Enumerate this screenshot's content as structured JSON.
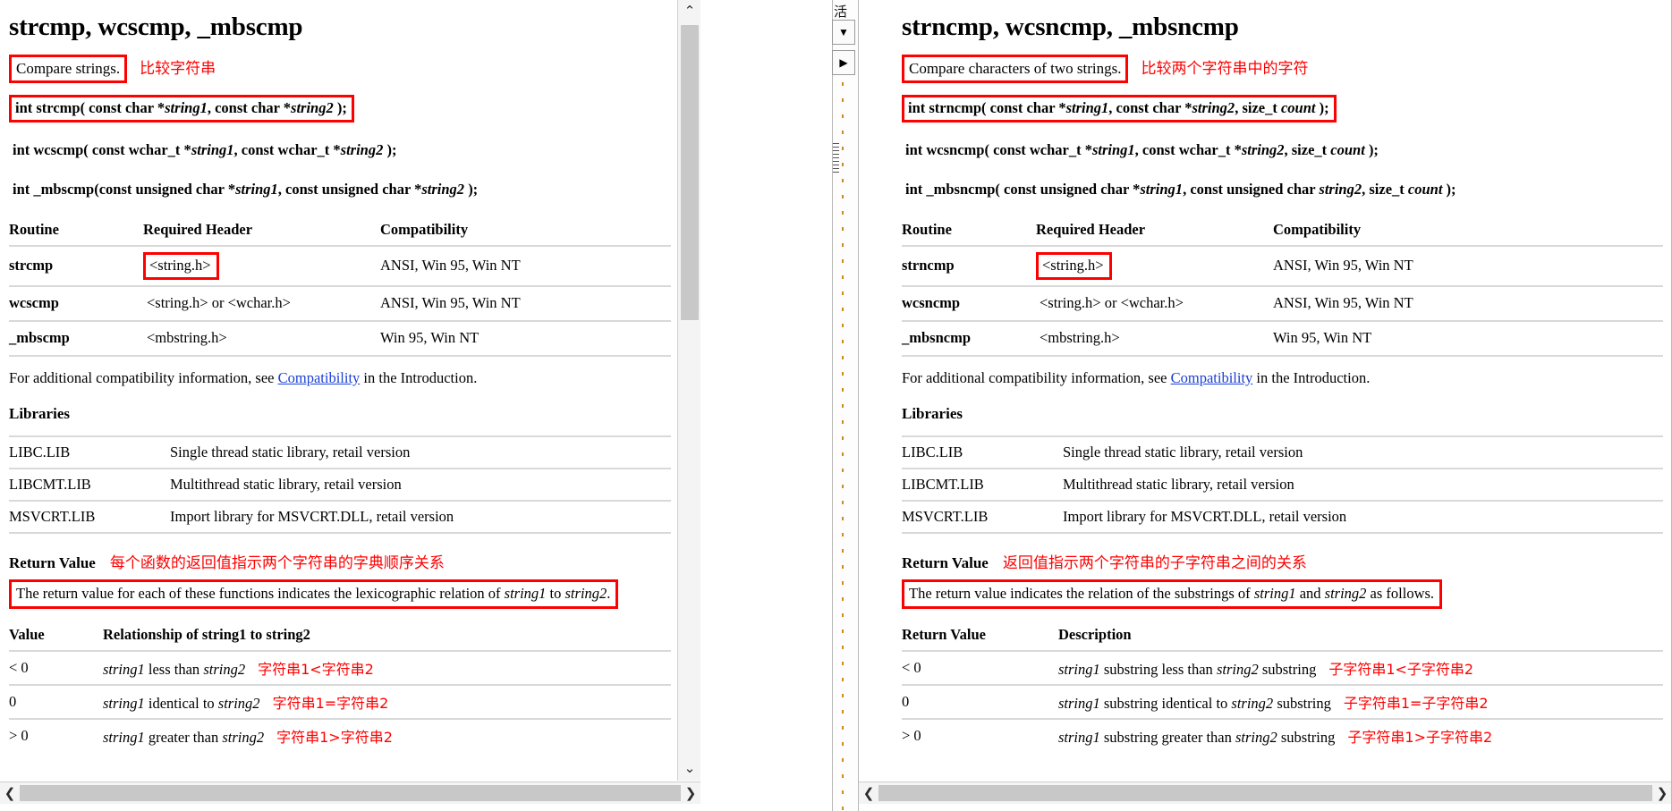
{
  "left": {
    "title": "strcmp, wcscmp, _mbscmp",
    "description": "Compare strings.",
    "description_cn": "比较字符串",
    "prototypes": [
      {
        "boxed": true,
        "parts": [
          {
            "t": "int strcmp( const char *",
            "i": false
          },
          {
            "t": "string1",
            "i": true
          },
          {
            "t": ", const char *",
            "i": false
          },
          {
            "t": "string2",
            "i": true
          },
          {
            "t": " );",
            "i": false
          }
        ]
      },
      {
        "boxed": false,
        "parts": [
          {
            "t": "int wcscmp( const wchar_t *",
            "i": false
          },
          {
            "t": "string1",
            "i": true
          },
          {
            "t": ", const wchar_t *",
            "i": false
          },
          {
            "t": "string2",
            "i": true
          },
          {
            "t": " );",
            "i": false
          }
        ]
      },
      {
        "boxed": false,
        "parts": [
          {
            "t": "int _mbscmp(const unsigned char *",
            "i": false
          },
          {
            "t": "string1",
            "i": true
          },
          {
            "t": ", const unsigned char *",
            "i": false
          },
          {
            "t": "string2",
            "i": true
          },
          {
            "t": " );",
            "i": false
          }
        ]
      }
    ],
    "routine_table": {
      "headers": [
        "Routine",
        "Required Header",
        "Compatibility"
      ],
      "rows": [
        {
          "routine": "strcmp",
          "header": "<string.h>",
          "header_boxed": true,
          "compat": "ANSI, Win 95, Win NT"
        },
        {
          "routine": "wcscmp",
          "header": "<string.h> or <wchar.h>",
          "header_boxed": false,
          "compat": "ANSI, Win 95, Win NT"
        },
        {
          "routine": "_mbscmp",
          "header": "<mbstring.h>",
          "header_boxed": false,
          "compat": "Win 95, Win NT"
        }
      ]
    },
    "note_before": "For additional compatibility information, see ",
    "note_link": "Compatibility",
    "note_after": " in the Introduction.",
    "libraries_heading": "Libraries",
    "libraries": [
      {
        "name": "LIBC.LIB",
        "desc": "Single thread static library, retail version"
      },
      {
        "name": "LIBCMT.LIB",
        "desc": "Multithread static library, retail version"
      },
      {
        "name": "MSVCRT.LIB",
        "desc": "Import library for MSVCRT.DLL, retail version"
      }
    ],
    "return_value_label": "Return Value",
    "return_value_cn": "每个函数的返回值指示两个字符串的字典顺序关系",
    "return_value_text_parts": [
      {
        "t": "The return value for each of these functions indicates the lexicographic relation of ",
        "i": false
      },
      {
        "t": "string1",
        "i": true
      },
      {
        "t": " to ",
        "i": false
      },
      {
        "t": "string2",
        "i": true
      },
      {
        "t": ".",
        "i": false
      }
    ],
    "value_table": {
      "headers": [
        "Value",
        "Relationship of string1 to string2"
      ],
      "rows": [
        {
          "value": "< 0",
          "parts": [
            {
              "t": "string1",
              "i": true
            },
            {
              "t": " less than ",
              "i": false
            },
            {
              "t": "string2",
              "i": true
            }
          ],
          "cn": "字符串1<字符串2"
        },
        {
          "value": "0",
          "parts": [
            {
              "t": "string1",
              "i": true
            },
            {
              "t": " identical to ",
              "i": false
            },
            {
              "t": "string2",
              "i": true
            }
          ],
          "cn": "字符串1=字符串2"
        },
        {
          "value": "> 0",
          "parts": [
            {
              "t": "string1",
              "i": true
            },
            {
              "t": " greater than ",
              "i": false
            },
            {
              "t": "string2",
              "i": true
            }
          ],
          "cn": "字符串1>字符串2"
        }
      ]
    }
  },
  "right": {
    "title": "strncmp, wcsncmp, _mbsncmp",
    "description": "Compare characters of two strings.",
    "description_cn": "比较两个字符串中的字符",
    "prototypes": [
      {
        "boxed": true,
        "parts": [
          {
            "t": "int strncmp( const char *",
            "i": false
          },
          {
            "t": "string1",
            "i": true
          },
          {
            "t": ", const char *",
            "i": false
          },
          {
            "t": "string2",
            "i": true
          },
          {
            "t": ", size_t ",
            "i": false
          },
          {
            "t": "count",
            "i": true
          },
          {
            "t": " );",
            "i": false
          }
        ]
      },
      {
        "boxed": false,
        "parts": [
          {
            "t": "int wcsncmp( const wchar_t *",
            "i": false
          },
          {
            "t": "string1",
            "i": true
          },
          {
            "t": ", const wchar_t *",
            "i": false
          },
          {
            "t": "string2",
            "i": true
          },
          {
            "t": ", size_t ",
            "i": false
          },
          {
            "t": "count",
            "i": true
          },
          {
            "t": " );",
            "i": false
          }
        ]
      },
      {
        "boxed": false,
        "parts": [
          {
            "t": "int _mbsncmp( const unsigned char *",
            "i": false
          },
          {
            "t": "string1",
            "i": true
          },
          {
            "t": ", const unsigned char ",
            "i": false
          },
          {
            "t": "string2",
            "i": true
          },
          {
            "t": ", size_t ",
            "i": false
          },
          {
            "t": "count",
            "i": true
          },
          {
            "t": " );",
            "i": false
          }
        ]
      }
    ],
    "routine_table": {
      "headers": [
        "Routine",
        "Required Header",
        "Compatibility"
      ],
      "rows": [
        {
          "routine": "strncmp",
          "header": "<string.h>",
          "header_boxed": true,
          "compat": "ANSI, Win 95, Win NT"
        },
        {
          "routine": "wcsncmp",
          "header": "<string.h> or <wchar.h>",
          "header_boxed": false,
          "compat": "ANSI, Win 95, Win NT"
        },
        {
          "routine": "_mbsncmp",
          "header": "<mbstring.h>",
          "header_boxed": false,
          "compat": "Win 95, Win NT"
        }
      ]
    },
    "note_before": "For additional compatibility information, see ",
    "note_link": "Compatibility",
    "note_after": " in the Introduction.",
    "libraries_heading": "Libraries",
    "libraries": [
      {
        "name": "LIBC.LIB",
        "desc": "Single thread static library, retail version"
      },
      {
        "name": "LIBCMT.LIB",
        "desc": "Multithread static library, retail version"
      },
      {
        "name": "MSVCRT.LIB",
        "desc": "Import library for MSVCRT.DLL, retail version"
      }
    ],
    "return_value_label": "Return Value",
    "return_value_cn": "返回值指示两个字符串的子字符串之间的关系",
    "return_value_text_parts": [
      {
        "t": "The return value indicates the relation of the substrings of ",
        "i": false
      },
      {
        "t": "string1",
        "i": true
      },
      {
        "t": " and ",
        "i": false
      },
      {
        "t": "string2",
        "i": true
      },
      {
        "t": " as follows.",
        "i": false
      }
    ],
    "value_table": {
      "headers": [
        "Return Value",
        "Description"
      ],
      "rows": [
        {
          "value": "< 0",
          "parts": [
            {
              "t": "string1",
              "i": true
            },
            {
              "t": " substring less than ",
              "i": false
            },
            {
              "t": "string2",
              "i": true
            },
            {
              "t": " substring",
              "i": false
            }
          ],
          "cn": "子字符串1<子字符串2"
        },
        {
          "value": "0",
          "parts": [
            {
              "t": "string1",
              "i": true
            },
            {
              "t": " substring identical to ",
              "i": false
            },
            {
              "t": "string2",
              "i": true
            },
            {
              "t": " substring",
              "i": false
            }
          ],
          "cn": "子字符串1=子字符串2"
        },
        {
          "value": "> 0",
          "parts": [
            {
              "t": "string1",
              "i": true
            },
            {
              "t": " substring greater than ",
              "i": false
            },
            {
              "t": "string2",
              "i": true
            },
            {
              "t": " substring",
              "i": false
            }
          ],
          "cn": "子字符串1>子字符串2"
        }
      ]
    }
  },
  "divider": {
    "label_cn": "活",
    "dropdown_icon": "▼",
    "play_icon": "▶"
  },
  "scrollbars": {
    "up_icon": "⌃",
    "down_icon": "⌄",
    "left_icon": "❮",
    "right_icon": "❯"
  },
  "colors": {
    "annotation_red": "#ff0000",
    "link_blue": "#1a3fd4",
    "rule_gray": "#d9d9d9",
    "scroll_thumb": "#c8c8c8"
  }
}
